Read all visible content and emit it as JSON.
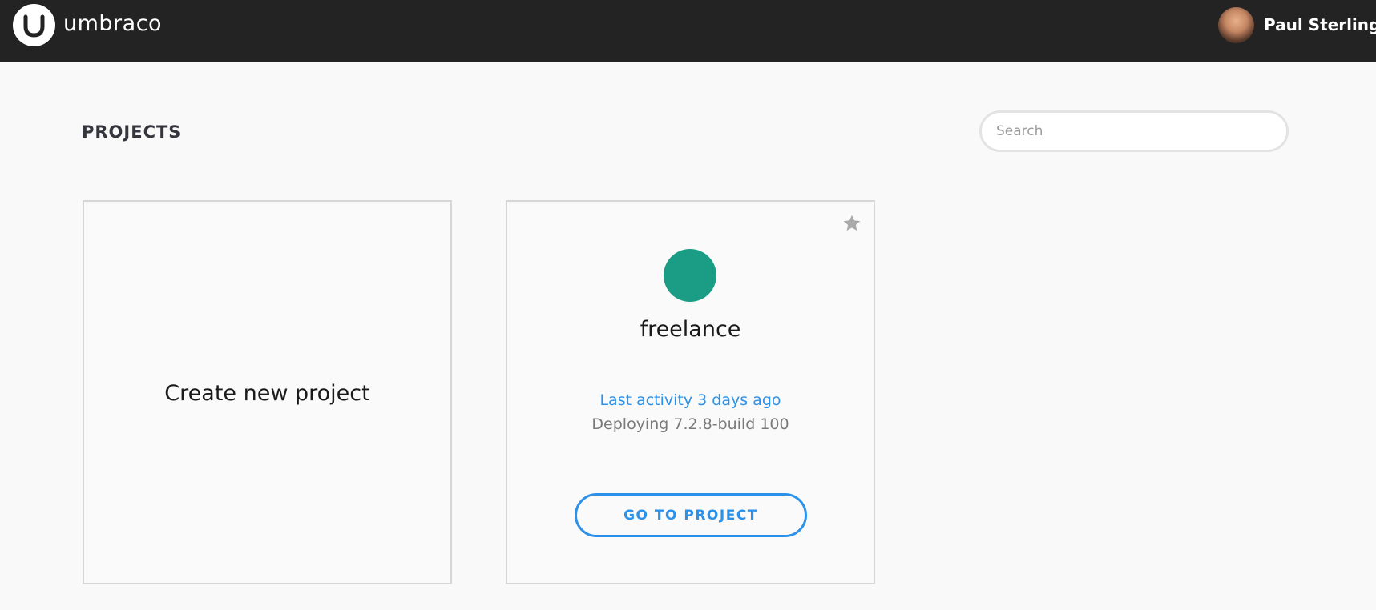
{
  "header": {
    "logo_text": "umbraco",
    "user_name": "Paul Sterling"
  },
  "page": {
    "title": "PROJECTS",
    "search_placeholder": "Search"
  },
  "cards": {
    "create": {
      "label": "Create new project"
    },
    "project": {
      "name": "freelance",
      "last_activity": "Last activity 3 days ago",
      "deploy_status": "Deploying 7.2.8-build 100",
      "button_label": "GO TO PROJECT",
      "favorite_icon": "star-icon"
    }
  },
  "colors": {
    "topbar_bg": "#232323",
    "accent_blue": "#2c91e8",
    "project_dot": "#1a9c85",
    "star": "#a9a9a9"
  }
}
